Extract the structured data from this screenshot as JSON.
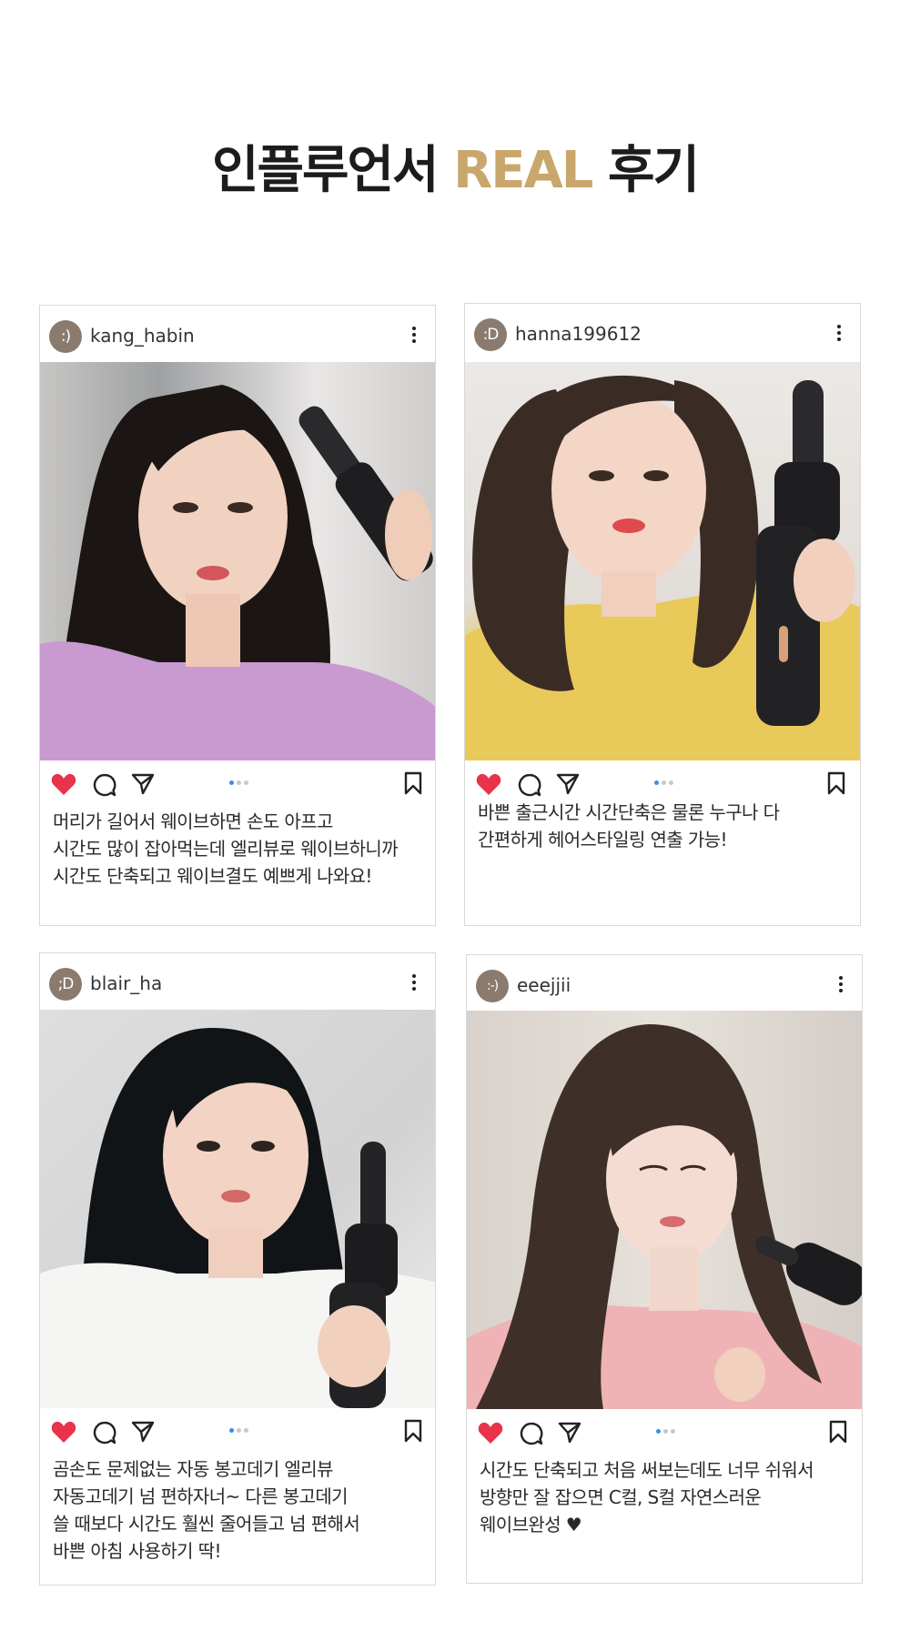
{
  "headline": {
    "part1": "인플루언서 ",
    "accent": "REAL",
    "part2": " 후기"
  },
  "colors": {
    "accent": "#c9a66b",
    "heart": "#e8334a",
    "avatar": "#8a7b6e",
    "active_dot": "#3c8de3"
  },
  "icons": [
    "heart-icon",
    "comment-icon",
    "share-icon",
    "bookmark-icon",
    "more-icon"
  ],
  "posts": [
    {
      "avatar": ":)",
      "username": "kang_habin",
      "caption": "머리가 길어서 웨이브하면 손도 아프고\n시간도 많이 잡아먹는데 엘리뷰로 웨이브하니까\n시간도 단축되고 웨이브결도 예쁘게 나와요!"
    },
    {
      "avatar": ":D",
      "username": "hanna199612",
      "caption": "바쁜 출근시간 시간단축은 물론 누구나 다\n간편하게 헤어스타일링 연출 가능!"
    },
    {
      "avatar": ";D",
      "username": "blair_ha",
      "caption": " 곰손도 문제없는 자동 봉고데기 엘리뷰\n자동고데기 넘 편하자너~ 다른 봉고데기\n쓸 때보다 시간도 훨씬 줄어들고 넘 편해서\n바쁜 아침 사용하기 딱!"
    },
    {
      "avatar": ":-)",
      "username": "eeejjii",
      "caption": "시간도 단축되고 처음 써보는데도 너무 쉬워서\n방향만 잘 잡으면 C컬, S컬 자연스러운\n웨이브완성 ♥"
    }
  ]
}
